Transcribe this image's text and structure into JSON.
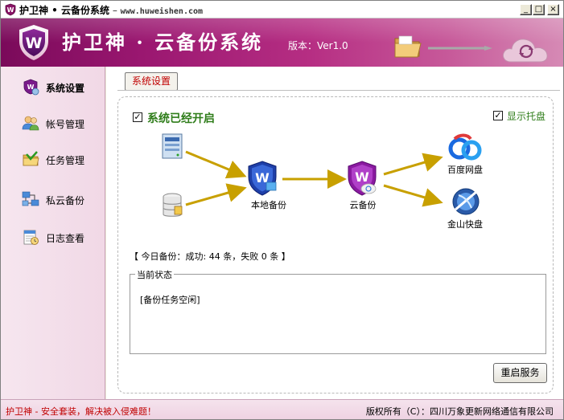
{
  "window": {
    "title": "护卫神 • 云备份系统",
    "title_sep": " – ",
    "url": "www.huweishen.com",
    "buttons": {
      "minimize": "_",
      "maximize": "□",
      "close": "×"
    }
  },
  "banner": {
    "app_title": "护卫神 · 云备份系统",
    "version": "版本：Ver1.0",
    "logo_letter": "W"
  },
  "sidebar": {
    "items": [
      {
        "label": "系统设置",
        "icon": "shield-gear-icon",
        "active": true
      },
      {
        "label": "帐号管理",
        "icon": "users-icon",
        "active": false
      },
      {
        "label": "任务管理",
        "icon": "folder-task-icon",
        "active": false
      },
      {
        "label": "私云备份",
        "icon": "network-icon",
        "active": false
      },
      {
        "label": "日志查看",
        "icon": "log-calendar-icon",
        "active": false
      }
    ]
  },
  "main": {
    "tab_label": "系统设置",
    "system_enabled": {
      "label": "系统已经开启",
      "checked": true,
      "mark": "✓"
    },
    "show_tray": {
      "label": "显示托盘",
      "checked": true,
      "mark": "✓"
    },
    "flow": {
      "local_backup_label": "本地备份",
      "cloud_backup_label": "云备份",
      "baidu_label": "百度网盘",
      "kingsoft_label": "金山快盘"
    },
    "summary": {
      "prefix": "【 今日备份：成功: ",
      "success": "44",
      "mid": " 条，失败 ",
      "failed": "0",
      "suffix": " 条 】"
    },
    "status_group": {
      "legend": "当前状态",
      "text": "[备份任务空闲]"
    },
    "restart_button": "重启服务"
  },
  "statusbar": {
    "left": "护卫神 - 安全套装，解决被入侵难题！",
    "right": "版权所有（C）：四川万象更新网络通信有限公司"
  },
  "colors": {
    "brand": "#9a1770",
    "sidebar_bg": "#f6e6ef",
    "enabled_green": "#2f7d1a",
    "arrow_gold": "#c8a000",
    "alert_red": "#c00000"
  }
}
